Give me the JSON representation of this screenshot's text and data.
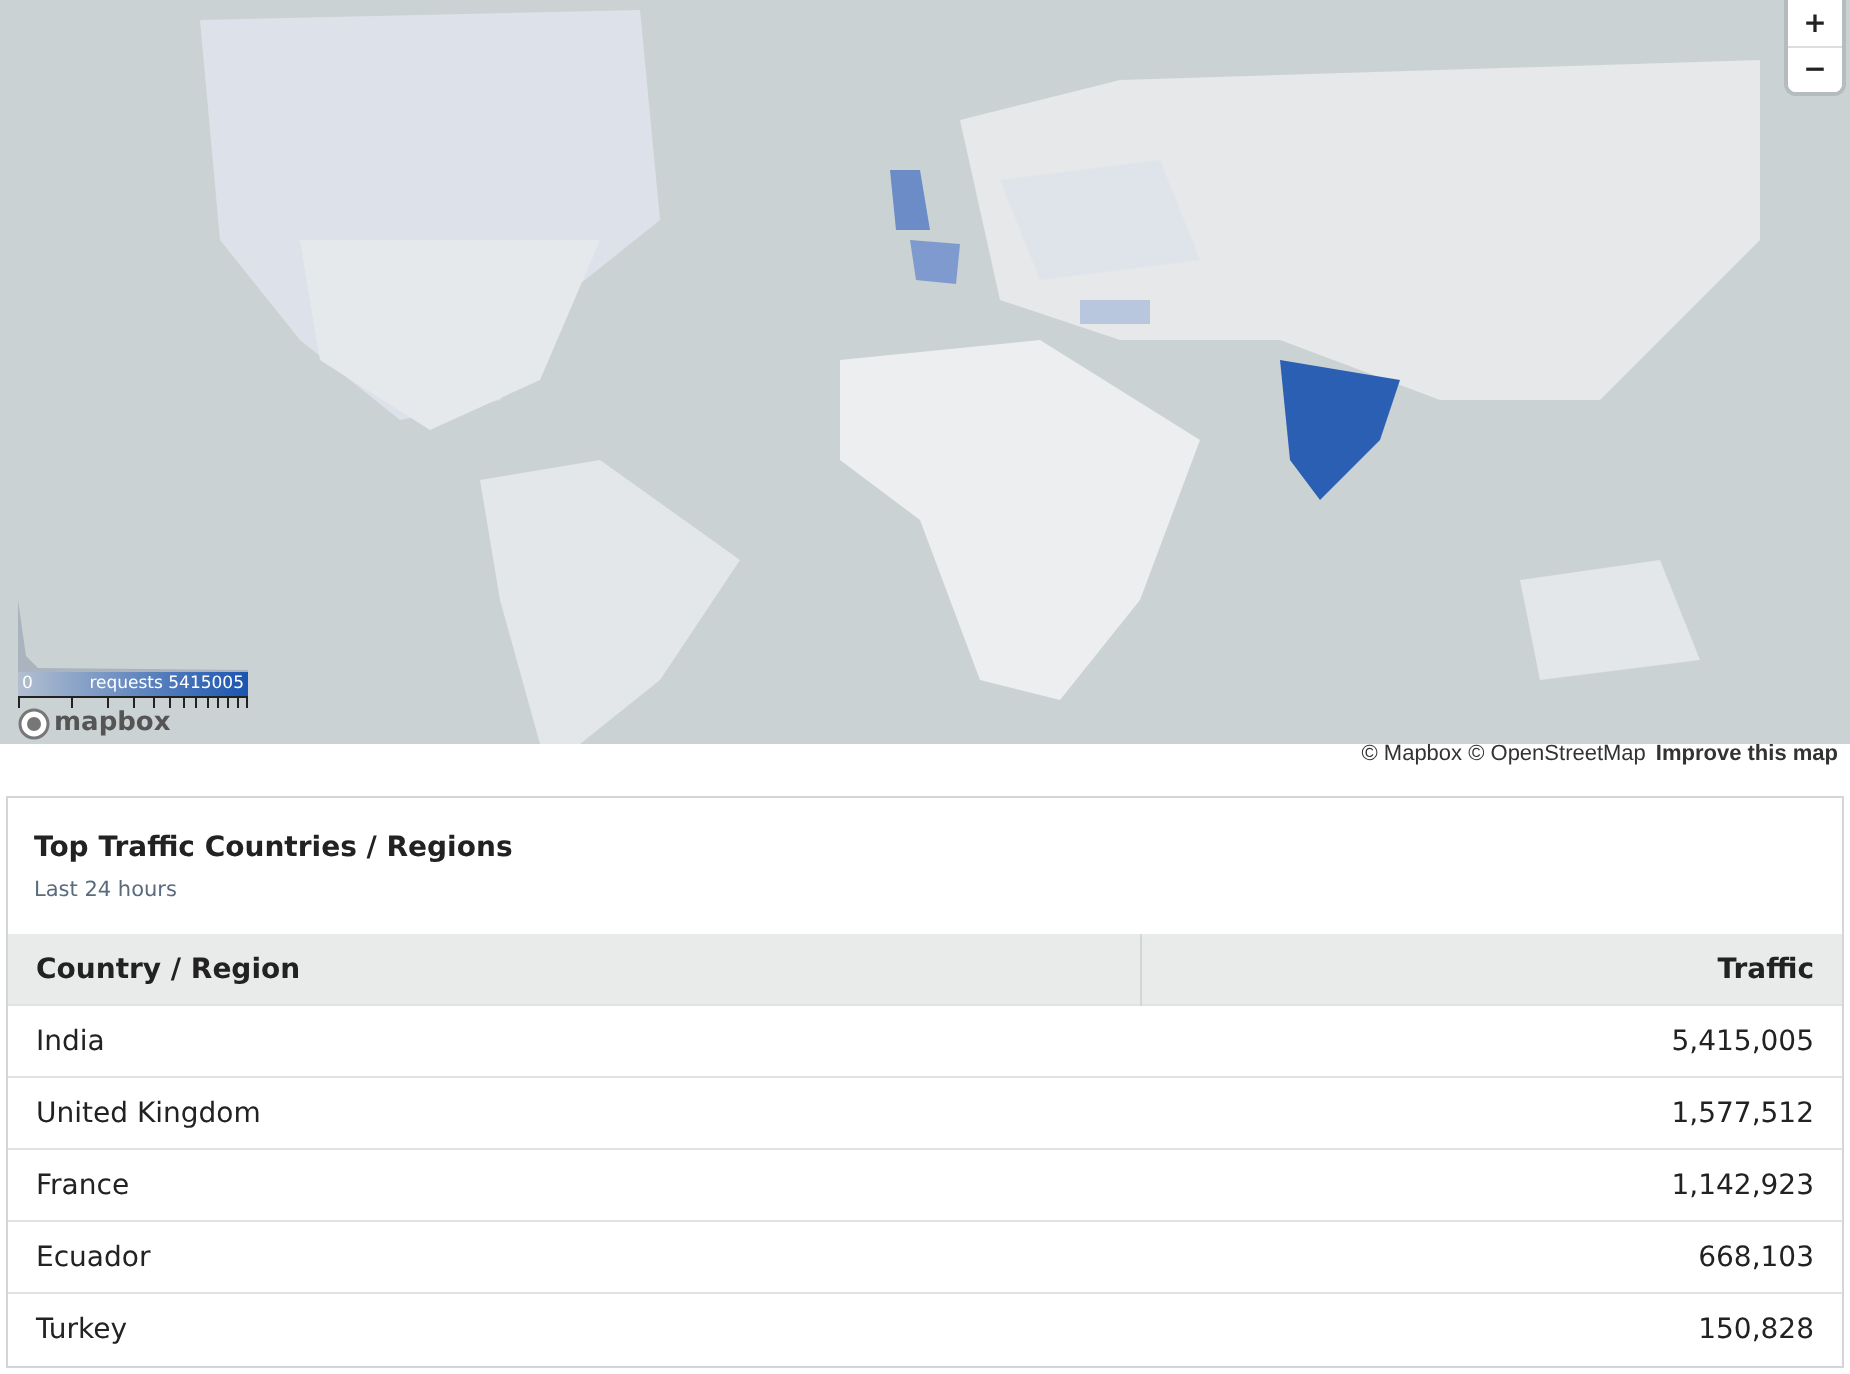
{
  "map": {
    "zoom_in": "+",
    "zoom_out": "−",
    "legend": {
      "min_label": "0",
      "max_label": "requests 5415005"
    },
    "logo": "mapbox",
    "attribution": "© Mapbox © OpenStreetMap",
    "improve_link": "Improve this map"
  },
  "panel": {
    "title": "Top Traffic Countries / Regions",
    "subtitle": "Last 24 hours",
    "columns": [
      "Country / Region",
      "Traffic"
    ],
    "rows": [
      {
        "country": "India",
        "traffic": "5,415,005"
      },
      {
        "country": "United Kingdom",
        "traffic": "1,577,512"
      },
      {
        "country": "France",
        "traffic": "1,142,923"
      },
      {
        "country": "Ecuador",
        "traffic": "668,103"
      },
      {
        "country": "Turkey",
        "traffic": "150,828"
      }
    ]
  }
}
